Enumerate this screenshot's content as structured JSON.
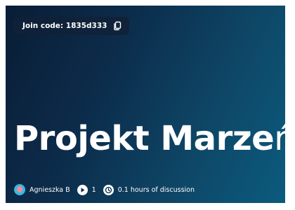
{
  "join": {
    "label": "Join code: 1835d333",
    "icon": "copy-icon"
  },
  "title": {
    "main": "Projekt Marze",
    "last": "ń"
  },
  "meta": {
    "author": "Agnieszka B",
    "plays": "1",
    "discussion": "0.1 hours of discussion",
    "icons": {
      "avatar": "avatar",
      "plays": "play-icon",
      "discussion": "clock-icon"
    }
  },
  "colors": {
    "background_start": "#0a1d35",
    "background_end": "#0b5b7e",
    "text": "#ffffff"
  }
}
